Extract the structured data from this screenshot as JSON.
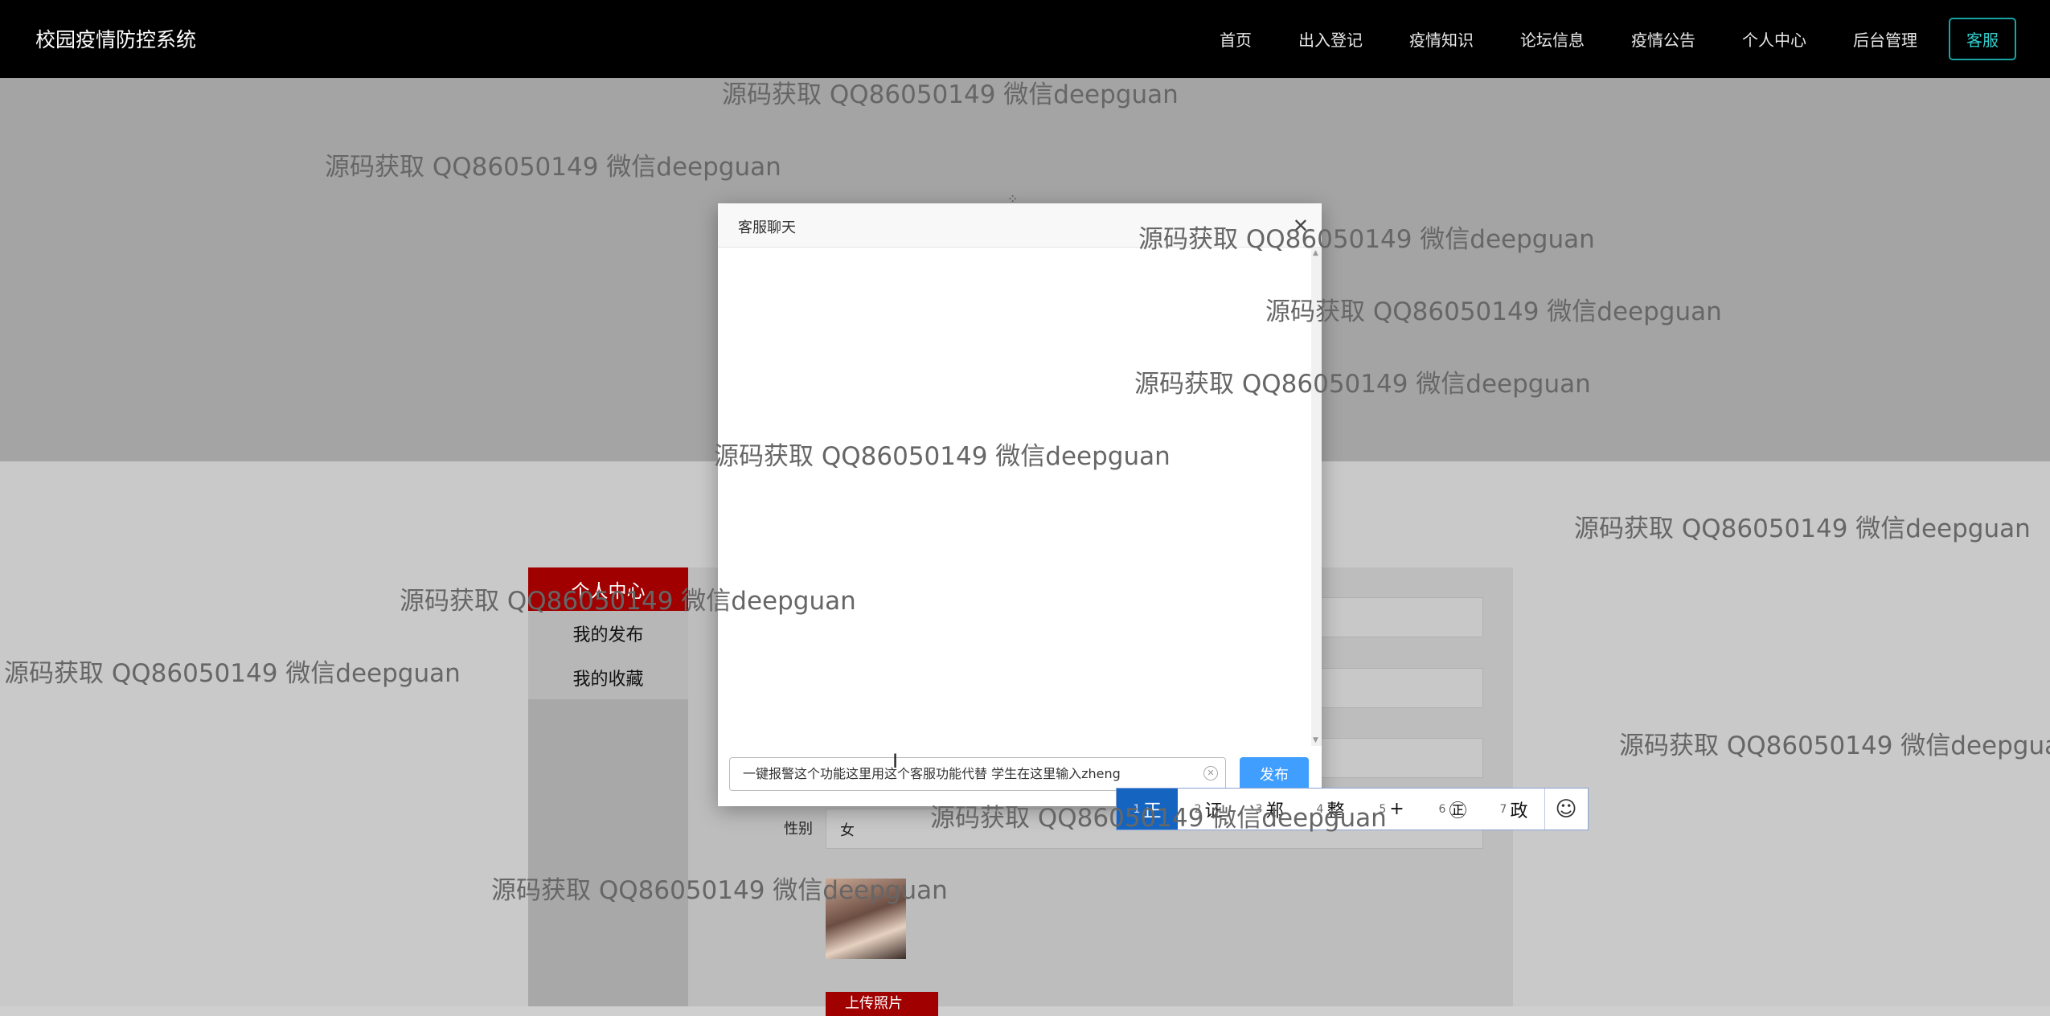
{
  "header": {
    "brand": "校园疫情防控系统",
    "nav": [
      "首页",
      "出入登记",
      "疫情知识",
      "论坛信息",
      "疫情公告",
      "个人中心",
      "后台管理"
    ],
    "service_button": "客服"
  },
  "sidebar": {
    "title": "个人中心",
    "items": [
      "我的发布",
      "我的收藏"
    ]
  },
  "form": {
    "gender_label": "性别",
    "gender_value": "女",
    "upload_label": "上传照片"
  },
  "dialog": {
    "title": "客服聊天",
    "close_icon": "close-icon",
    "input_value": "一键报警这个功能这里用这个客服功能代替  学生在这里输入zheng",
    "send_label": "发布"
  },
  "ime": {
    "candidates": [
      {
        "n": "1",
        "text": "正"
      },
      {
        "n": "2",
        "text": "证"
      },
      {
        "n": "3",
        "text": "郑"
      },
      {
        "n": "4",
        "text": "整"
      },
      {
        "n": "5",
        "text": "+"
      },
      {
        "n": "6",
        "text": "㊣"
      },
      {
        "n": "7",
        "text": "政"
      }
    ],
    "emoji_icon": "smiley-icon",
    "emoji_glyph": "☺"
  },
  "watermark_text": "源码获取 QQ86050149 微信deepguan",
  "accent_colors": {
    "nav_bg": "#000000",
    "sidebar_active": "#a00000",
    "send_button": "#409eff",
    "ime_selected": "#1565c0"
  }
}
